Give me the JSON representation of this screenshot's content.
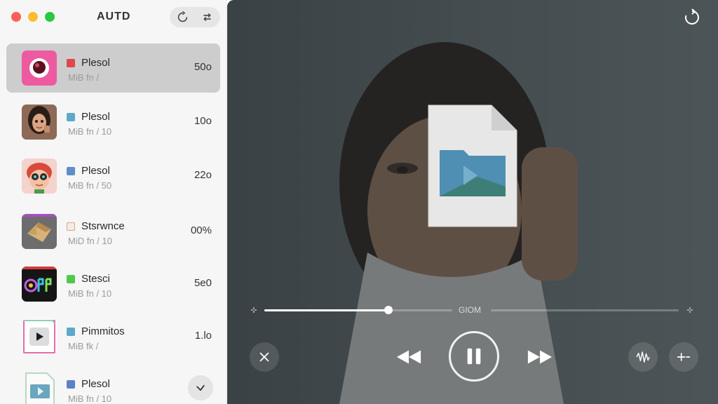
{
  "window": {
    "title": "AUTD"
  },
  "sidebar": {
    "items": [
      {
        "name": "Plesol",
        "meta": "MiB fn /",
        "value": "50o",
        "badge_color": "#e0474c",
        "thumb": "pink-app",
        "selected": true
      },
      {
        "name": "Plesol",
        "meta": "MiB fn / 10",
        "value": "10o",
        "badge_color": "#5fa9c7",
        "thumb": "portrait-woman",
        "selected": false
      },
      {
        "name": "Plesol",
        "meta": "MiB fn / 50",
        "value": "22o",
        "badge_color": "#5f8fc7",
        "thumb": "cartoon-face",
        "selected": false
      },
      {
        "name": "Stsrwnce",
        "meta": "MiD fn / 10",
        "value": "00%",
        "badge_color": "#e0a08a",
        "thumb": "craft-paper",
        "selected": false
      },
      {
        "name": "Stesci",
        "meta": "MiB fn / 10",
        "value": "5e0",
        "badge_color": "#4ec94e",
        "thumb": "graffiti",
        "selected": false
      },
      {
        "name": "Pimmitos",
        "meta": "MiB fk /",
        "value": "1.lo",
        "badge_color": "#5fa9c7",
        "thumb": "play-document",
        "selected": false
      },
      {
        "name": "Plesol",
        "meta": "MiB fn / 10",
        "value": "",
        "badge_color": "#5f7fc7",
        "thumb": "video-document",
        "selected": false
      }
    ]
  },
  "player": {
    "seek_label": "GIOM",
    "progress": 0.66,
    "state": "playing"
  },
  "icons": {
    "refresh": "refresh-icon",
    "swap": "swap-arrows-icon",
    "scroll": "chevron-down-icon",
    "close": "close-icon",
    "rewind": "rewind-icon",
    "pause": "pause-icon",
    "forward": "fast-forward-icon",
    "waveform": "waveform-icon",
    "add": "add-icon",
    "rotate": "rotate-icon",
    "file": "video-file-icon"
  }
}
